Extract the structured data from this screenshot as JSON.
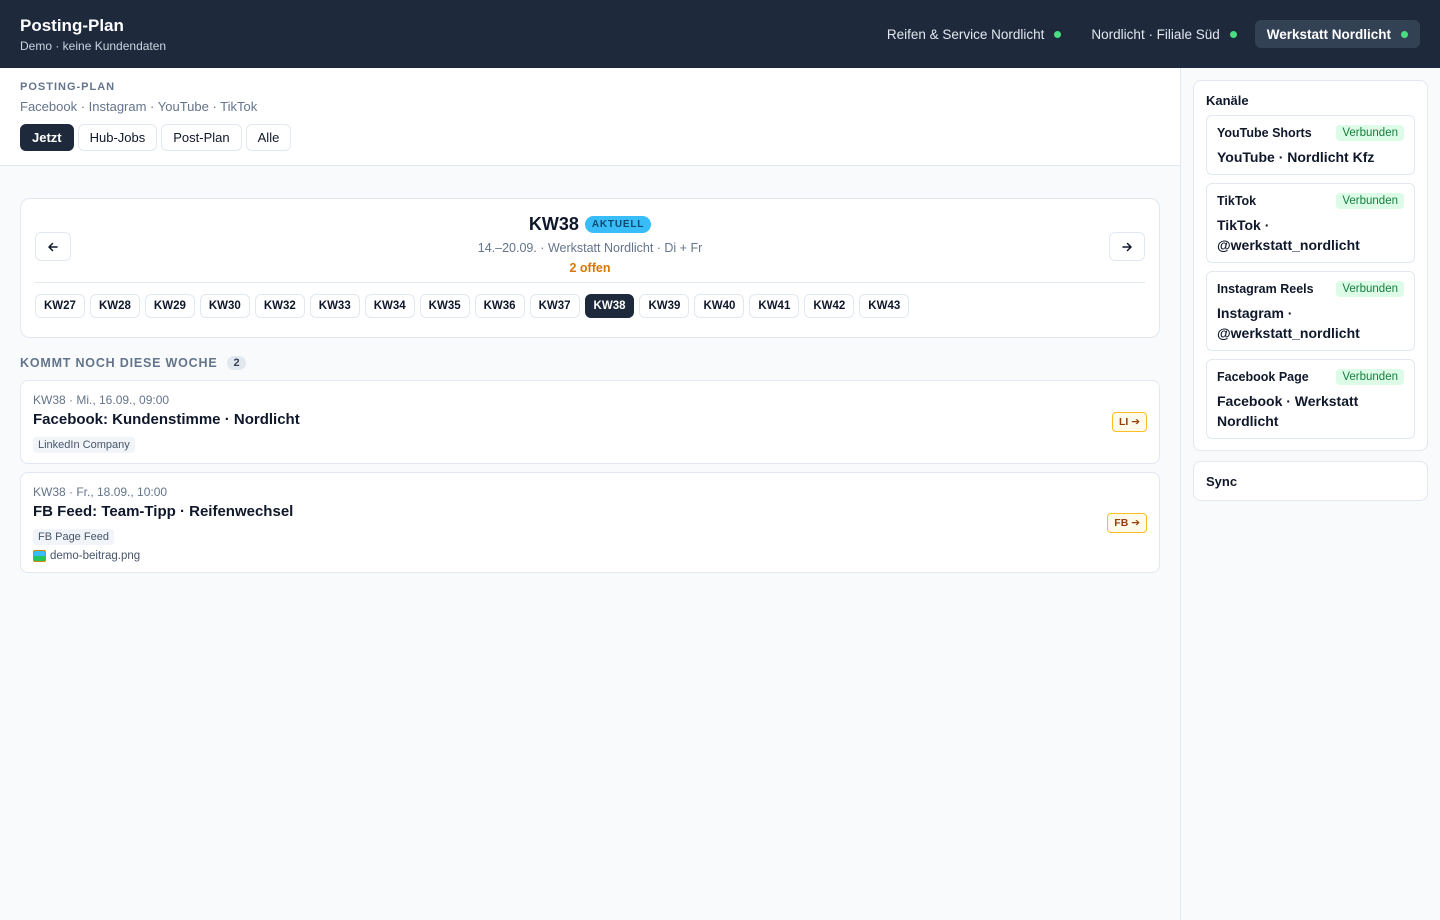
{
  "app": {
    "title": "Posting-Plan",
    "subtitle": "Demo · keine Kundendaten"
  },
  "locations": [
    {
      "label": "Reifen & Service Nordlicht",
      "active": false
    },
    {
      "label": "Nordlicht · Filiale Süd",
      "active": false
    },
    {
      "label": "Werkstatt Nordlicht",
      "active": true
    }
  ],
  "subheader": {
    "kicker": "POSTING-PLAN",
    "channels": "Facebook · Instagram · YouTube · TikTok",
    "tabs": [
      {
        "label": "Jetzt",
        "active": true
      },
      {
        "label": "Hub-Jobs",
        "active": false
      },
      {
        "label": "Post-Plan",
        "active": false
      },
      {
        "label": "Alle",
        "active": false
      }
    ]
  },
  "week": {
    "title": "KW38",
    "badge": "AKTUELL",
    "range": "14.–20.09. · Werkstatt Nordlicht · Di + Fr",
    "open": "2 offen",
    "prev_icon": "arrow-left-icon",
    "next_icon": "arrow-right-icon",
    "chips": [
      "KW27",
      "KW28",
      "KW29",
      "KW30",
      "KW32",
      "KW33",
      "KW34",
      "KW35",
      "KW36",
      "KW37",
      "KW38",
      "KW39",
      "KW40",
      "KW41",
      "KW42",
      "KW43"
    ],
    "active_chip": "KW38"
  },
  "upcoming": {
    "title": "KOMMT NOCH DIESE WOCHE",
    "count": "2",
    "posts": [
      {
        "meta": "KW38 · Mi., 16.09., 09:00",
        "title": "Facebook: Kundenstimme · Nordlicht",
        "tag": "LinkedIn Company",
        "file": "",
        "badge": "LI ➔"
      },
      {
        "meta": "KW38 · Fr., 18.09., 10:00",
        "title": "FB Feed: Team-Tipp · Reifenwechsel",
        "tag": "FB Page Feed",
        "file": "demo-beitrag.png",
        "badge": "FB ➔"
      }
    ]
  },
  "sidebar": {
    "channels_title": "Kanäle",
    "channels": [
      {
        "name": "YouTube Shorts",
        "status": "Verbunden",
        "account": "YouTube · Nordlicht Kfz"
      },
      {
        "name": "TikTok",
        "status": "Verbunden",
        "account": "TikTok · @werkstatt_nordlicht"
      },
      {
        "name": "Instagram Reels",
        "status": "Verbunden",
        "account": "Instagram · @werkstatt_nordlicht"
      },
      {
        "name": "Facebook Page",
        "status": "Verbunden",
        "account": "Facebook · Werkstatt Nordlicht"
      }
    ],
    "sync_title": "Sync"
  },
  "colors": {
    "topbar": "#1e293b",
    "accent": "#38bdf8",
    "open": "#d97706",
    "connected": "#15803d",
    "status_dot": "#4ade80"
  }
}
